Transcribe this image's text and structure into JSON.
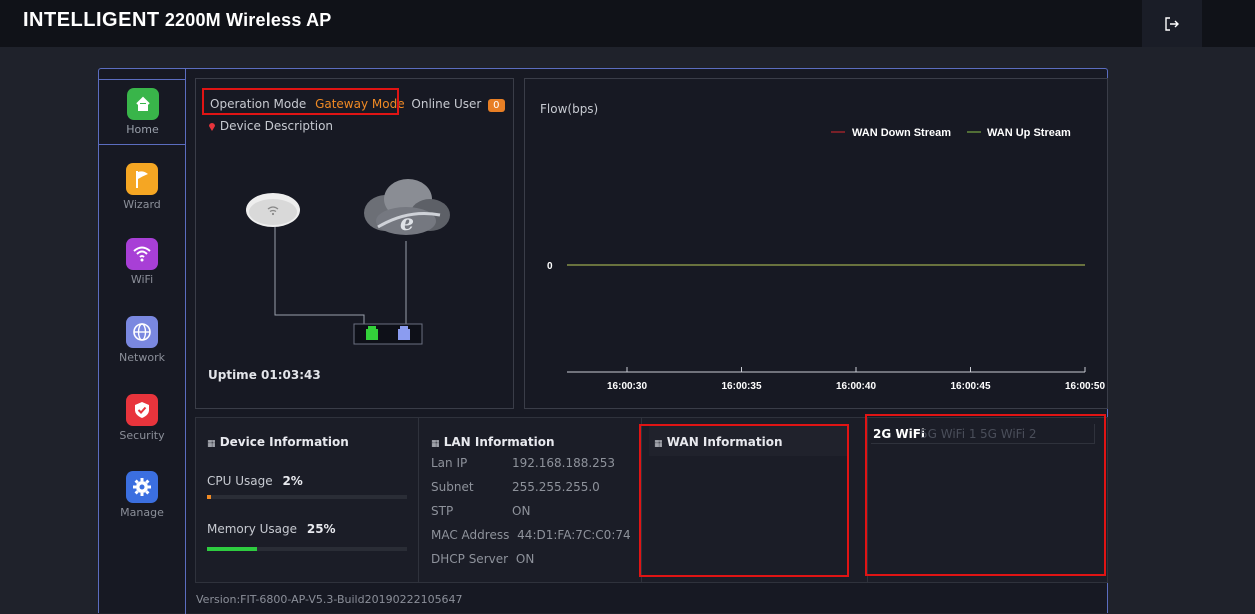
{
  "header": {
    "brand_big": "INTELLIGENT",
    "brand_rest": "2200M Wireless AP",
    "logout_icon": "logout-icon"
  },
  "sidebar": {
    "items": [
      {
        "label": "Home",
        "icon": "home-icon",
        "color": "#39b54a",
        "active": true
      },
      {
        "label": "Wizard",
        "icon": "flag-icon",
        "color": "#f5a623"
      },
      {
        "label": "WiFi",
        "icon": "wifi-icon",
        "color": "#a83fd6"
      },
      {
        "label": "Network",
        "icon": "globe-icon",
        "color": "#7a88e0"
      },
      {
        "label": "Security",
        "icon": "shield-icon",
        "color": "#e8343c"
      },
      {
        "label": "Manage",
        "icon": "gear-icon",
        "color": "#3b6fe0"
      }
    ]
  },
  "status": {
    "operation_mode_label": "Operation Mode",
    "operation_mode_value": "Gateway Mode",
    "online_user_label": "Online User",
    "online_user_count": "0",
    "device_description": "Device Description",
    "uptime": "Uptime 01:03:43"
  },
  "flow": {
    "title": "Flow(bps)",
    "legend_down": "WAN Down Stream",
    "legend_up": "WAN Up Stream",
    "down_color": "#d9262c",
    "up_color": "#8bc34a"
  },
  "chart_data": {
    "type": "line",
    "x": [
      "16:00:30",
      "16:00:35",
      "16:00:40",
      "16:00:45",
      "16:00:50"
    ],
    "series": [
      {
        "name": "WAN Down Stream",
        "values": [
          0,
          0,
          0,
          0,
          0
        ]
      },
      {
        "name": "WAN Up Stream",
        "values": [
          0,
          0,
          0,
          0,
          0
        ]
      }
    ],
    "ytick": "0",
    "title": "Flow(bps)",
    "legend": "top-right",
    "grid": false
  },
  "device_info": {
    "title": "Device Information",
    "cpu_label": "CPU Usage",
    "cpu_value": "2%",
    "cpu_fraction": 0.02,
    "mem_label": "Memory Usage",
    "mem_value": "25%",
    "mem_fraction": 0.25
  },
  "lan": {
    "title": "LAN Information",
    "rows": [
      {
        "k": "Lan IP",
        "v": "192.168.188.253"
      },
      {
        "k": "Subnet",
        "v": "255.255.255.0"
      },
      {
        "k": "STP",
        "v": "ON"
      },
      {
        "k": "MAC Address",
        "v": "44:D1:FA:7C:C0:74"
      },
      {
        "k": "DHCP Server",
        "v": "ON"
      }
    ]
  },
  "wan": {
    "title": "WAN Information"
  },
  "wifi_tabs": [
    "2G WiFi",
    "5G WiFi 1",
    "5G WiFi 2"
  ],
  "footer": {
    "version": "Version:FIT-6800-AP-V5.3-Build20190222105647"
  }
}
